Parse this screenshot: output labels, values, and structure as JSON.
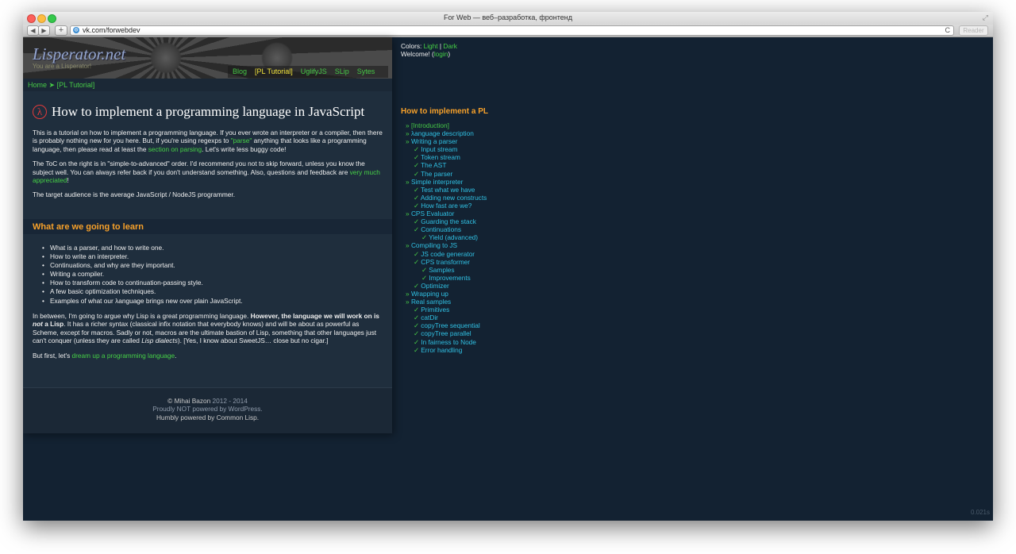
{
  "window": {
    "title": "For Web — веб–разработка, фронтенд"
  },
  "browser": {
    "url": "vk.com/forwebdev",
    "reader_label": "Reader",
    "plus_label": "+",
    "back": "◀",
    "forward": "▶",
    "reload": "C"
  },
  "site": {
    "logo": "Lisperator.net",
    "tagline": "You are a Lisperator!",
    "nav": [
      {
        "label": "Blog"
      },
      {
        "label": "[PL Tutorial]"
      },
      {
        "label": "UglifyJS"
      },
      {
        "label": "SLip"
      },
      {
        "label": "Sytes"
      }
    ],
    "breadcrumb": {
      "home": "Home",
      "sep": "➤",
      "current": "[PL Tutorial]"
    }
  },
  "article": {
    "lambda_icon": "λ",
    "title": "How to implement a programming language in JavaScript",
    "p1_a": "This is a tutorial on how to implement a programming language. If you ever wrote an interpreter or a compiler, then there is probably nothing new for you here. But, if you're using regexps to ",
    "p1_link1": "\"parse\"",
    "p1_b": " anything that looks like a programming language, then please read at least the ",
    "p1_link2": "section on parsing",
    "p1_c": ". Let's write less buggy code!",
    "p2_a": "The ToC on the right is in \"simple-to-advanced\" order. I'd recommend you not to skip forward, unless you know the subject well. You can always refer back if you don't understand something. Also, questions and feedback are ",
    "p2_link": "very much appreciated",
    "p2_b": "!",
    "p3": "The target audience is the average JavaScript / NodeJS programmer.",
    "h2": "What are we going to learn",
    "learn_items": [
      "What is a parser, and how to write one.",
      "How to write an interpreter.",
      "Continuations, and why are they important.",
      "Writing a compiler.",
      "How to transform code to continuation-passing style.",
      "A few basic optimization techniques.",
      "Examples of what our λanguage brings new over plain JavaScript."
    ],
    "p4_a": "In between, I'm going to argue why Lisp is a great programming language. ",
    "p4_bold1": "However, the language we will work on is ",
    "p4_bold_italic": "not",
    "p4_bold2": " a Lisp",
    "p4_b": ". It has a richer syntax (classical infix notation that everybody knows) and will be about as powerful as Scheme, except for macros. Sadly or not, macros are the ultimate bastion of Lisp, something that other languages just can't conquer (unless they are called ",
    "p4_italic": "Lisp dialects",
    "p4_c": "). [Yes, I know about SweetJS… close but no cigar.]",
    "p5_a": "But first, let's ",
    "p5_link": "dream up a programming language",
    "p5_b": "."
  },
  "footer": {
    "copy_a": "© Mihai Bazon",
    "copy_b": " 2012 - 2014",
    "line2": "Proudly NOT powered by WordPress.",
    "line3": "Humbly powered by Common Lisp."
  },
  "sidebar": {
    "colors_label": "Colors: ",
    "color_light": "Light",
    "color_sep": " | ",
    "color_dark": "Dark",
    "welcome": "Welcome! (",
    "login": "login",
    "welcome_end": ")",
    "toc_title": "How to implement a PL",
    "toc": [
      {
        "mark": "»",
        "label": "[Introduction]",
        "level": 0,
        "current": true
      },
      {
        "mark": "»",
        "label": "λanguage description",
        "level": 0
      },
      {
        "mark": "»",
        "label": "Writing a parser",
        "level": 0
      },
      {
        "mark": "✓",
        "label": "Input stream",
        "level": 1
      },
      {
        "mark": "✓",
        "label": "Token stream",
        "level": 1
      },
      {
        "mark": "✓",
        "label": "The AST",
        "level": 1
      },
      {
        "mark": "✓",
        "label": "The parser",
        "level": 1
      },
      {
        "mark": "»",
        "label": "Simple interpreter",
        "level": 0
      },
      {
        "mark": "✓",
        "label": "Test what we have",
        "level": 1
      },
      {
        "mark": "✓",
        "label": "Adding new constructs",
        "level": 1
      },
      {
        "mark": "✓",
        "label": "How fast are we?",
        "level": 1
      },
      {
        "mark": "»",
        "label": "CPS Evaluator",
        "level": 0
      },
      {
        "mark": "✓",
        "label": "Guarding the stack",
        "level": 1
      },
      {
        "mark": "✓",
        "label": "Continuations",
        "level": 1
      },
      {
        "mark": "✓",
        "label": "Yield (advanced)",
        "level": 2
      },
      {
        "mark": "»",
        "label": "Compiling to JS",
        "level": 0
      },
      {
        "mark": "✓",
        "label": "JS code generator",
        "level": 1
      },
      {
        "mark": "✓",
        "label": "CPS transformer",
        "level": 1
      },
      {
        "mark": "✓",
        "label": "Samples",
        "level": 2
      },
      {
        "mark": "✓",
        "label": "Improvements",
        "level": 2
      },
      {
        "mark": "✓",
        "label": "Optimizer",
        "level": 1
      },
      {
        "mark": "»",
        "label": "Wrapping up",
        "level": 0
      },
      {
        "mark": "»",
        "label": "Real samples",
        "level": 0
      },
      {
        "mark": "✓",
        "label": "Primitives",
        "level": 1
      },
      {
        "mark": "✓",
        "label": "catDir",
        "level": 1
      },
      {
        "mark": "✓",
        "label": "copyTree sequential",
        "level": 1
      },
      {
        "mark": "✓",
        "label": "copyTree parallel",
        "level": 1
      },
      {
        "mark": "✓",
        "label": "In fairness to Node",
        "level": 1
      },
      {
        "mark": "✓",
        "label": "Error handling",
        "level": 1
      }
    ]
  },
  "timer": "0.021s"
}
